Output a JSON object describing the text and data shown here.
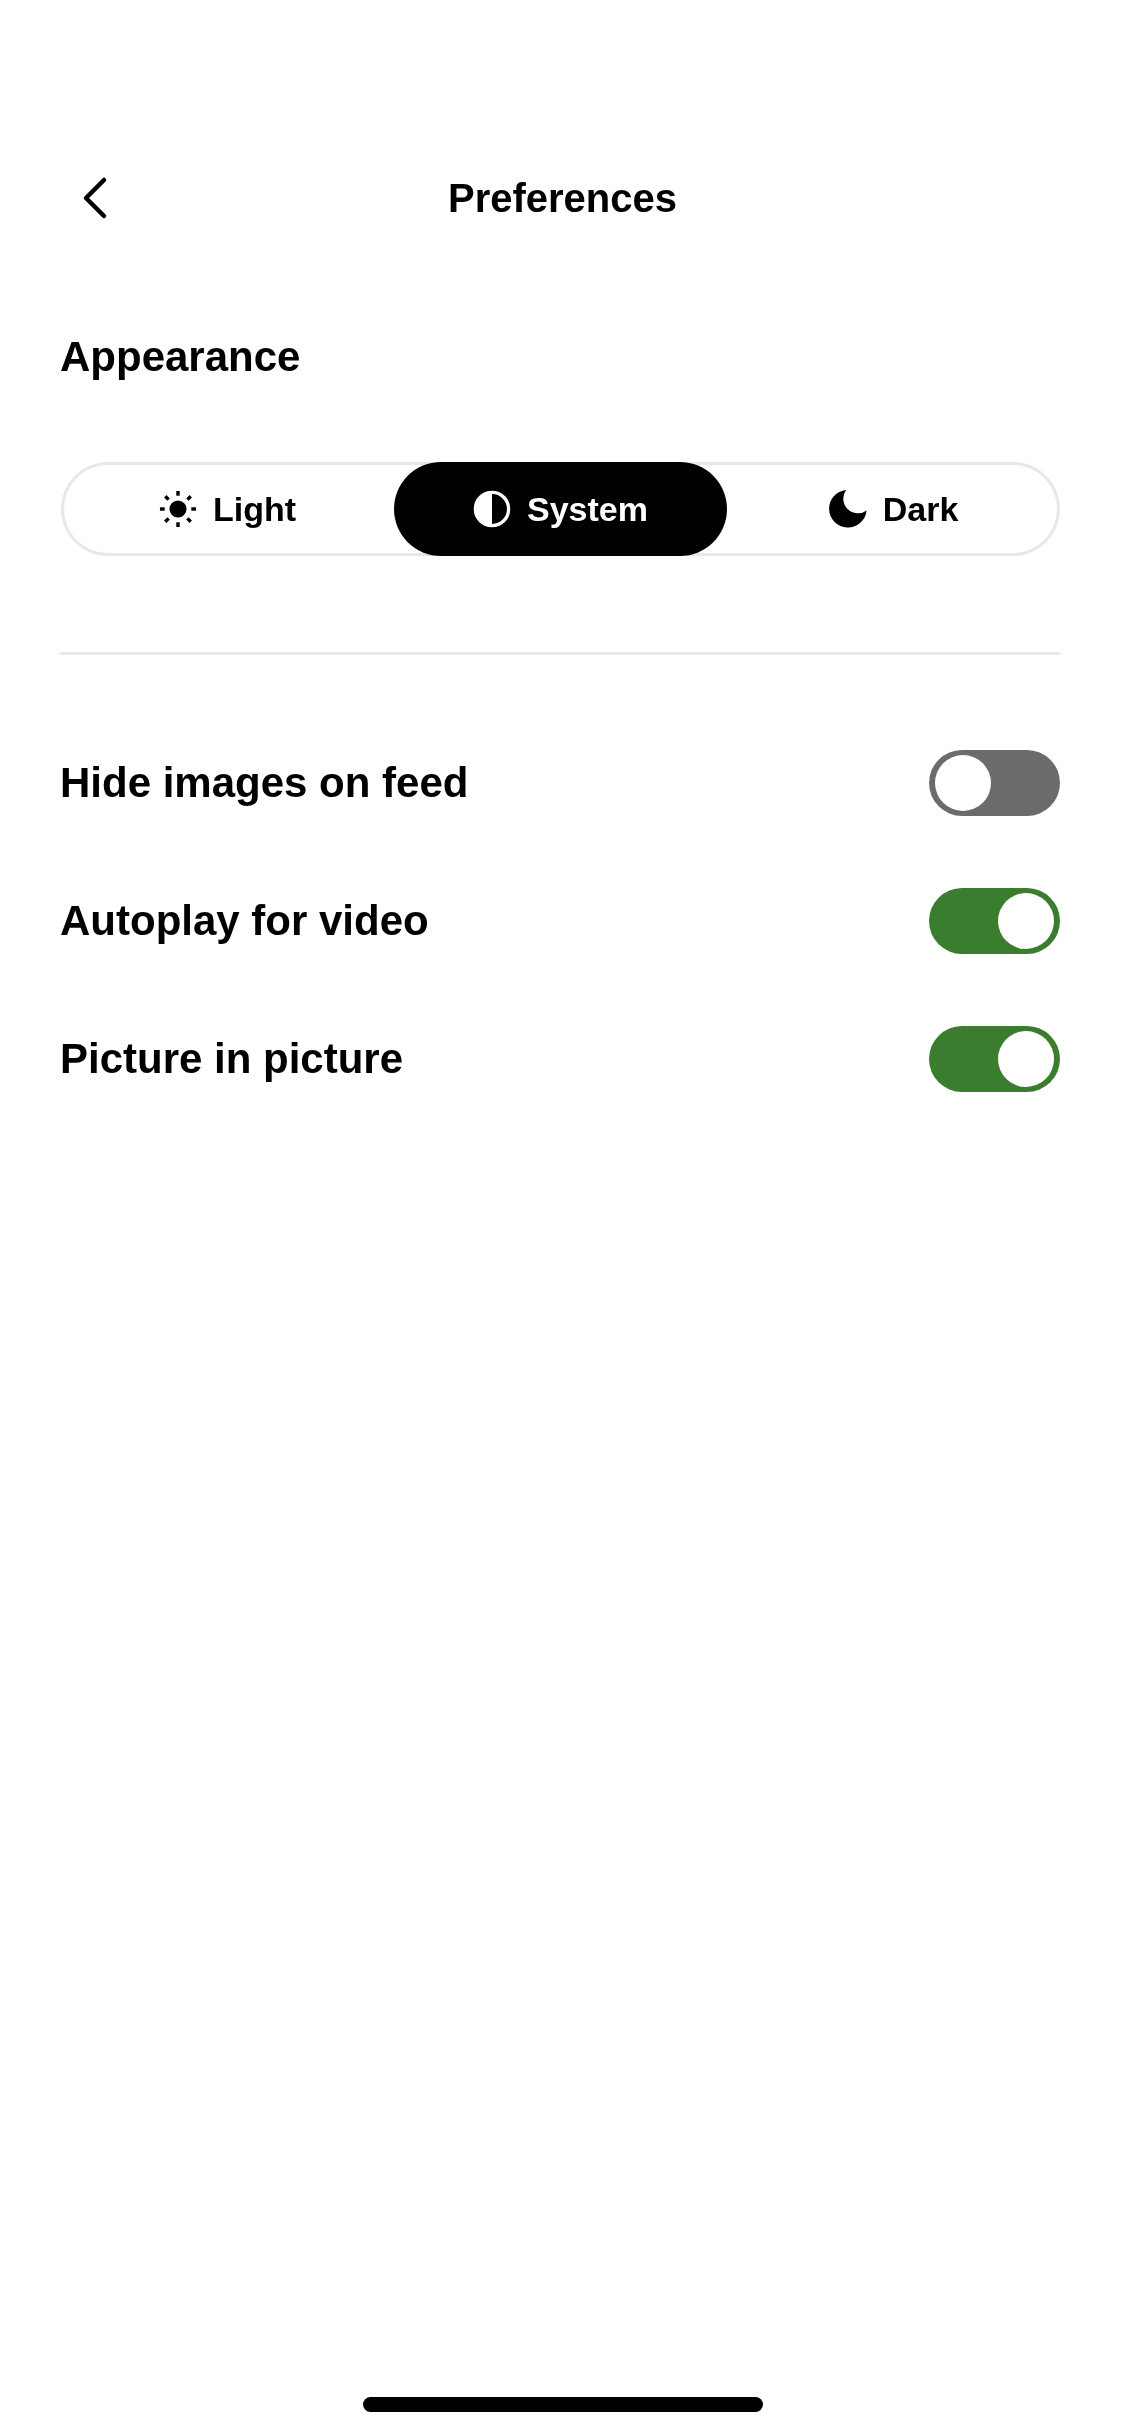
{
  "header": {
    "title": "Preferences"
  },
  "appearance": {
    "heading": "Appearance",
    "options": [
      {
        "kind": "light",
        "label": "Light",
        "selected": false
      },
      {
        "kind": "system",
        "label": "System",
        "selected": true
      },
      {
        "kind": "dark",
        "label": "Dark",
        "selected": false
      }
    ]
  },
  "settings": [
    {
      "label": "Hide images on feed",
      "on": false
    },
    {
      "label": "Autoplay for video",
      "on": true
    },
    {
      "label": "Picture in picture",
      "on": true
    }
  ]
}
